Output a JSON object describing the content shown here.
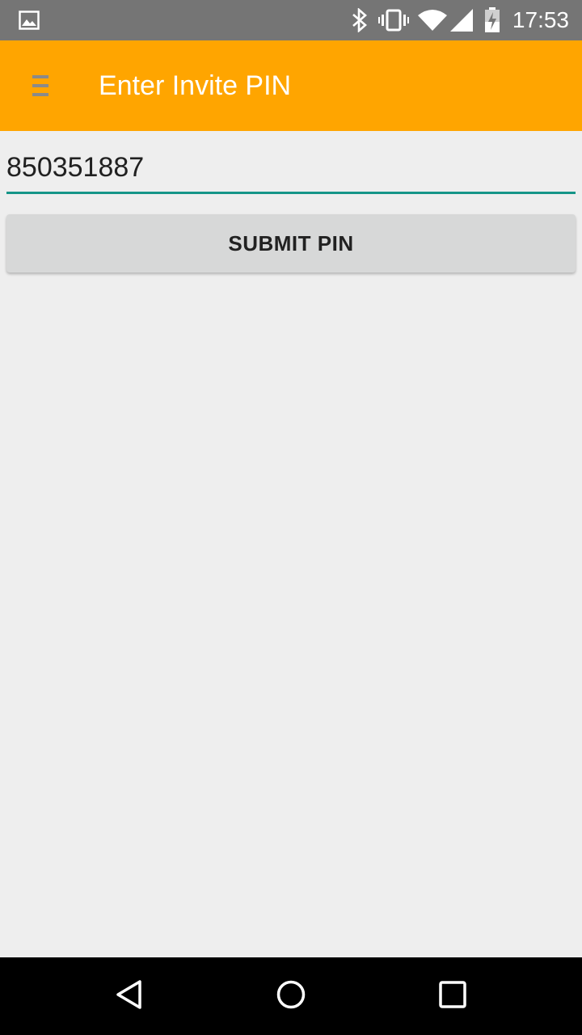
{
  "status_bar": {
    "time": "17:53",
    "icons": [
      "image-notification-icon",
      "bluetooth-icon",
      "vibrate-icon",
      "wifi-icon",
      "signal-icon",
      "battery-charging-icon"
    ],
    "background": "#757575"
  },
  "app_bar": {
    "title": "Enter Invite PIN",
    "background": "#ffa500"
  },
  "pin_input": {
    "value": "850351887",
    "underline_color": "#159588"
  },
  "submit": {
    "label": "SUBMIT PIN"
  },
  "nav_bar": {
    "buttons": [
      "back-icon",
      "home-icon",
      "recents-icon"
    ]
  }
}
